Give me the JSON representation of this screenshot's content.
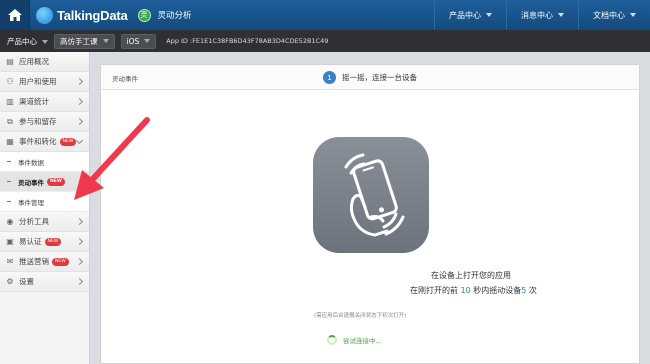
{
  "header": {
    "brand": "TalkingData",
    "product_icon_label": "灵",
    "product_name": "灵动分析",
    "menu": [
      {
        "label": "产品中心"
      },
      {
        "label": "消息中心"
      },
      {
        "label": "文档中心"
      }
    ]
  },
  "subbar": {
    "product_center_label": "产品中心",
    "app_selected": "高仿手工课",
    "platform_selected": "iOS",
    "app_id": "App ID :FE1E1C38FB6D43F78AB3D4CDE52B1C49"
  },
  "sidebar": {
    "items": [
      {
        "label": "应用概况"
      },
      {
        "label": "用户和使用"
      },
      {
        "label": "渠道统计"
      },
      {
        "label": "参与和留存"
      },
      {
        "label": "事件和转化",
        "badge": "NEW"
      },
      {
        "label": "事件数据"
      },
      {
        "label": "灵动事件",
        "badge": "NEW"
      },
      {
        "label": "事件管理"
      },
      {
        "label": "分析工具"
      },
      {
        "label": "易认证",
        "badge": "NEW"
      },
      {
        "label": "推送营销",
        "badge": "NEW"
      },
      {
        "label": "设置"
      }
    ]
  },
  "panel": {
    "title": "灵动事件",
    "step_number": "1",
    "step_text": "摇一摇，连接一台设备",
    "instruction_line1": "在设备上打开您的应用",
    "instruction_line2_prefix": "在刚打开的前",
    "instruction_seconds": "10",
    "instruction_line2_mid": "秒内摇动设备",
    "instruction_times": "5",
    "instruction_line2_suffix": "次",
    "note": "(需应用后台退报关闭状态下初次打开)",
    "status": "尝试连接中..."
  },
  "colors": {
    "topbar": "#1a5590",
    "subbar": "#2e3033",
    "accent_blue": "#3b7fc4",
    "status_green": "#4fa43c",
    "new_badge": "#e0393e",
    "annotation_arrow": "#f0394d"
  }
}
